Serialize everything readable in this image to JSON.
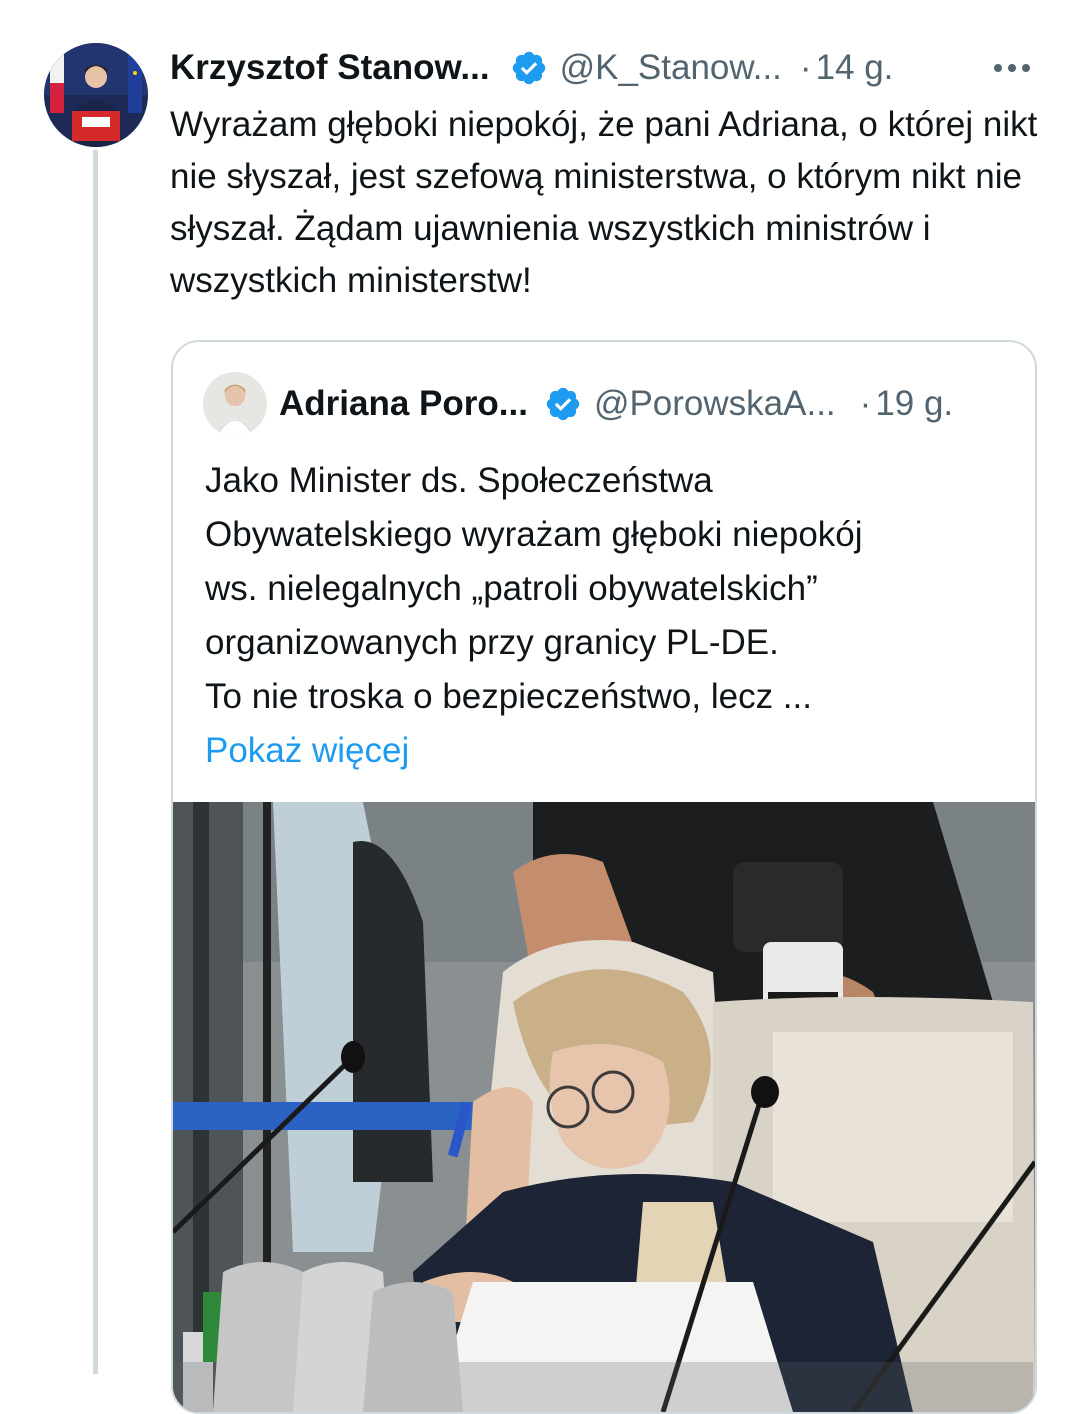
{
  "tweet": {
    "author_name": "Krzysztof Stanow...",
    "handle": "@K_Stanow...",
    "separator": "·",
    "time": "14 g.",
    "more_label": "•••",
    "text": "Wyrażam głęboki niepokój, że pani Adriana, o której nikt nie słyszał, jest szefową ministerstwa, o którym nikt nie słyszał. Żądam ujawnienia wszystkich ministrów i wszystkich ministerstw!"
  },
  "quoted": {
    "author_name": "Adriana Poro...",
    "handle": "@PorowskaA...",
    "separator": "·",
    "time": "19 g.",
    "text_lines": [
      "Jako Minister ds. Społeczeństwa",
      "Obywatelskiego wyrażam głęboki niepokój",
      "ws. nielegalnych „patroli obywatelskich”",
      "organizowanych przy granicy PL-DE.",
      "To nie troska o bezpieczeństwo, lecz ..."
    ],
    "show_more": "Pokaż więcej"
  },
  "colors": {
    "verified_badge": "#1d9bf0",
    "link": "#1d9bf0",
    "secondary_text": "#536471",
    "border": "#cfd9de"
  },
  "icons": [
    "verified-badge-icon",
    "more-options-icon"
  ]
}
